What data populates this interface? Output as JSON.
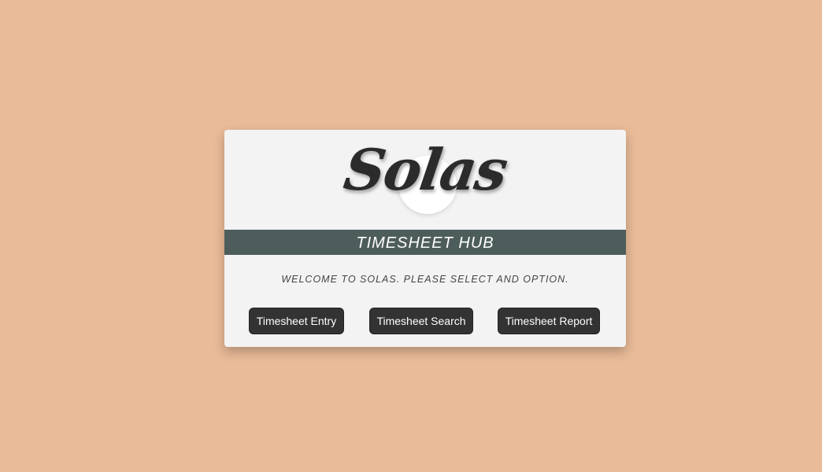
{
  "logo": {
    "text": "Solas"
  },
  "banner": {
    "title": "TIMESHEET HUB"
  },
  "welcome": {
    "message": "WELCOME TO SOLAS. PLEASE SELECT AND OPTION."
  },
  "buttons": {
    "entry": "Timesheet Entry",
    "search": "Timesheet Search",
    "report": "Timesheet Report"
  },
  "colors": {
    "page_background": "#e9bb98",
    "card_background": "#f3f3f3",
    "banner_background": "#4d5d5b",
    "button_background": "#333333"
  }
}
